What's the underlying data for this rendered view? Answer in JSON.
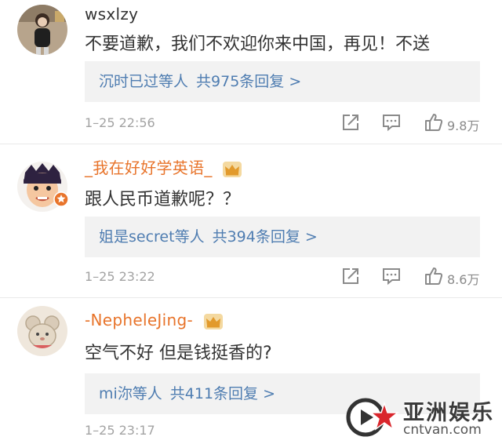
{
  "comments": [
    {
      "username": "wsxlzy",
      "text": "不要道歉，我们不欢迎你来中国，再见！不送",
      "replies_who": "沉时已过等人",
      "replies_count": "共975条回复 >",
      "time": "1–25 22:56",
      "likes": "9.8万"
    },
    {
      "username": "_我在好好学英语_",
      "text": "跟人民币道歉呢？？",
      "replies_who": "姐是secret等人",
      "replies_count": "共394条回复 >",
      "time": "1–25 23:22",
      "likes": "8.6万"
    },
    {
      "username": "-NepheleJing-",
      "text": "空气不好 但是钱挺香的?",
      "replies_who": "mi沵等人",
      "replies_count": "共411条回复 >",
      "time": "1–25 23:17",
      "likes": ""
    }
  ],
  "watermark": {
    "title": "亚洲娱乐",
    "url": "cntvan.com"
  },
  "colors": {
    "username_vip": "#e8742b",
    "reply_link": "#4f7db1",
    "reply_bg": "#f2f2f2",
    "meta": "#a3a3a3"
  },
  "icons": [
    "share-icon",
    "comment-icon",
    "like-icon",
    "crown-icon"
  ]
}
